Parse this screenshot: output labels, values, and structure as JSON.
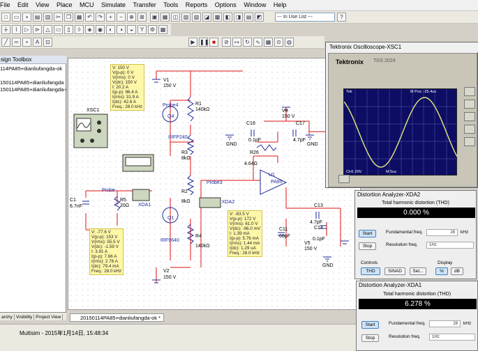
{
  "menu": [
    "File",
    "Edit",
    "View",
    "Place",
    "MCU",
    "Simulate",
    "Transfer",
    "Tools",
    "Reports",
    "Options",
    "Window",
    "Help"
  ],
  "toolbar": {
    "inuse_list": "--- In Use List ---",
    "help_icon": "help-icon"
  },
  "left_panel": {
    "title": "sign Toolbox",
    "items": [
      "114PA85+dianliufangda-ok",
      "150114PA85+dianliufangda",
      "150114PA85+dianliufangda-ok"
    ],
    "tabs": [
      "archy",
      "Visibility",
      "Project View"
    ]
  },
  "schematic": {
    "components": {
      "v1": "V1",
      "v1_val": "150 V",
      "r1": "R1",
      "r1_val": "140kΩ",
      "q4": "Q4",
      "q4_part": "IRFP240",
      "r3": "R3",
      "r3_val": "8kΩ",
      "r2": "R2",
      "r2_val": "8kΩ",
      "q1": "Q1",
      "q1_part": "IRF9640",
      "r4": "R4",
      "r4_val": "140kΩ",
      "v2": "V2",
      "v2_val": "150 V",
      "c1": "C1",
      "c1_val": "6.7nF",
      "r5": "R5",
      "r5_val": "20Ω",
      "xda1": "XDA1",
      "xsc1": "XSC1",
      "probe1": "Probe",
      "probe4": "Probe4",
      "probe3": "Probe3",
      "xda2": "XDA2",
      "c16": "C16",
      "c16_val": "0.1pF",
      "c17": "C17",
      "c17_val": "4.7pF",
      "v6": "V6",
      "v6_val": "150 V",
      "r26": "R26",
      "r26_val": "4.64Ω",
      "u1": "U1",
      "u1_part": "PA85",
      "c13": "C13",
      "c13_val": "4.7pF",
      "c14": "C14",
      "c14_val": "0.1pF",
      "c11": "C11",
      "c11_val": "68pF",
      "v5": "V5",
      "v5_val": "150 V",
      "gnd": "GND"
    },
    "probe_readings": {
      "p1": [
        "V: 150 V",
        "V(p-p): 0 V",
        "V(rms): 0 V",
        "V(dc): 150 V",
        "I: 20.2 A",
        "I(p-p): 96.4 A",
        "I(rms): 31.9 A",
        "I(dc): 42.6 A",
        "Freq.: 28.0 kHz"
      ],
      "p2": [
        "V: -77.6 V",
        "V(p-p): 153 V",
        "V(rms): 55.5 V",
        "V(dc): -1.59 V",
        "I: 3.91 A",
        "I(p-p): 7.66 A",
        "I(rms): 2.78 A",
        "I(dc): 79.4 mA",
        "Freq.: 28.0 kHz"
      ],
      "p3": [
        "V: -83.5 V",
        "V(p-p): 172 V",
        "V(rms): 61.0 V",
        "V(dc): -96.0 mV",
        "I: 1.39 mA",
        "I(p-p): 5.76 mA",
        "I(rms): 1.44 mA",
        "I(dc): 1.29 uA",
        "Freq.: 28.0 kHz"
      ]
    }
  },
  "doc_tab": "20150114PA85+dianliufangda-ok *",
  "status": "Multisim  -  2015年1月14日, 15:48:34",
  "oscilloscope": {
    "title": "Tektronix Oscilloscope-XSC1",
    "brand": "Tektronix",
    "model": "TDS 2024",
    "screen_top_left": "Tek",
    "screen_top_right": "M Pos: -25.4us",
    "screen_ch1": "CH1 20V",
    "screen_time": "M 5us",
    "wave_color": "#d8e07a"
  },
  "xda2": {
    "title": "Distortion Analyzer-XDA2",
    "thd_label": "Total harmonic distortion (THD)",
    "thd_value": "0.000 %",
    "start": "Start",
    "stop": "Stop",
    "fund_label": "Fundamental freq.",
    "fund_value": "28",
    "fund_unit": "kHz",
    "res_label": "Resolution freq.",
    "res_value": "1Hz",
    "controls_label": "Controls",
    "display_label": "Display",
    "btn_thd": "THD",
    "btn_sinad": "SINAD",
    "btn_set": "Set...",
    "btn_pct": "%",
    "btn_db": "dB"
  },
  "xda1": {
    "title": "Distortion Analyzer-XDA1",
    "thd_label": "Total harmonic distortion (THD)",
    "thd_value": "6.278 %",
    "start": "Start",
    "stop": "Stop",
    "fund_label": "Fundamental freq.",
    "fund_value": "28",
    "fund_unit": "kHz",
    "res_label": "Resolution freq.",
    "res_value": "1Hz"
  }
}
